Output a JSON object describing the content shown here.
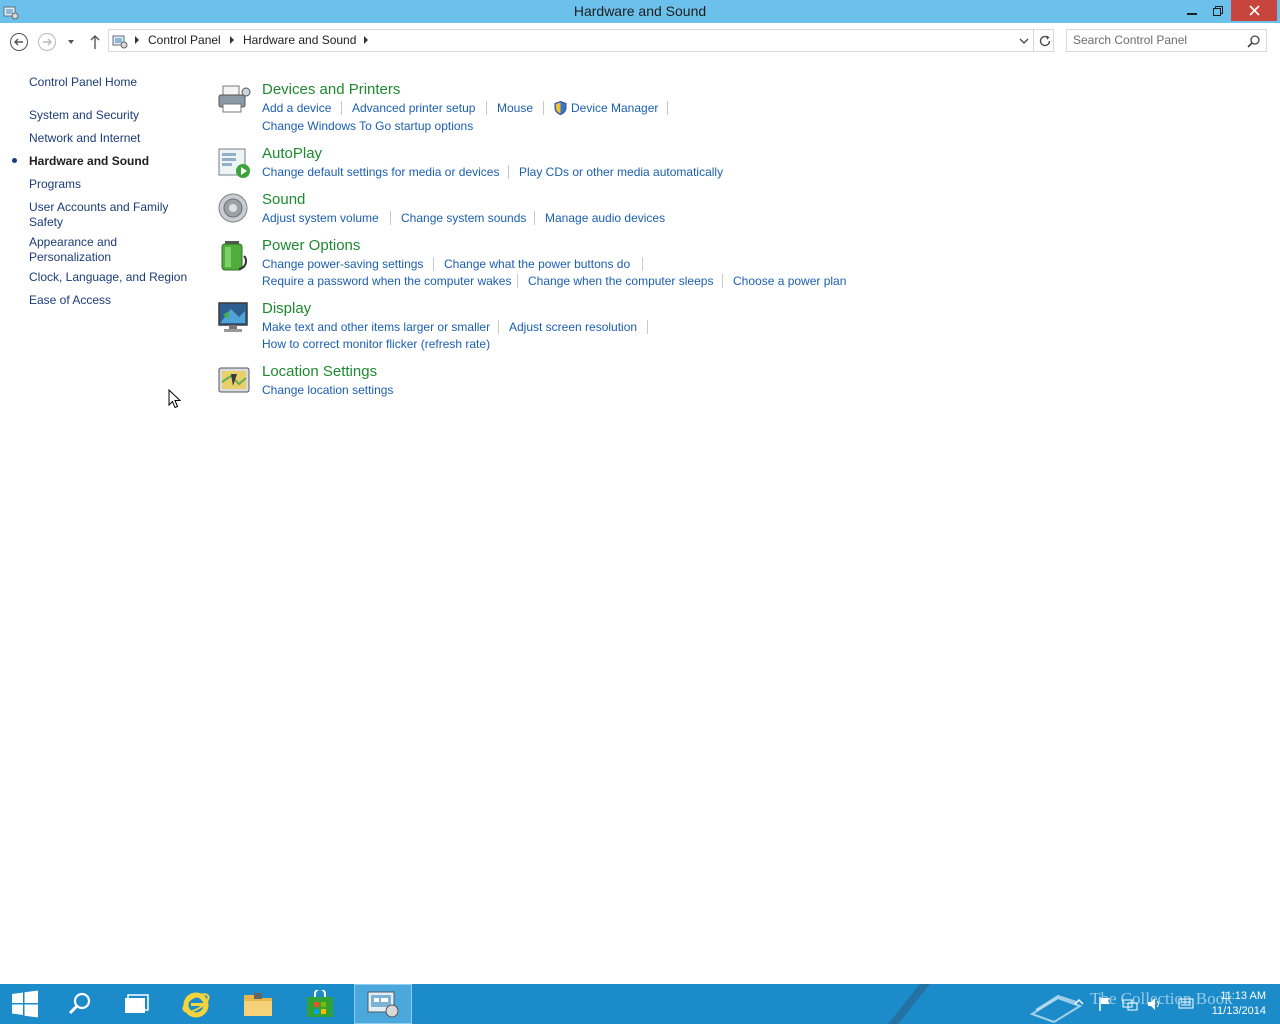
{
  "window": {
    "title": "Hardware and Sound"
  },
  "address": {
    "crumbs": [
      "Control Panel",
      "Hardware and Sound"
    ]
  },
  "search": {
    "placeholder": "Search Control Panel"
  },
  "left_pane": {
    "items": [
      {
        "label": "Control Panel Home"
      },
      {
        "label": "System and Security"
      },
      {
        "label": "Network and Internet"
      },
      {
        "label": "Hardware and Sound",
        "current": true
      },
      {
        "label": "Programs"
      },
      {
        "label": "User Accounts and Family Safety"
      },
      {
        "label": "Appearance and Personalization"
      },
      {
        "label": "Clock, Language, and Region"
      },
      {
        "label": "Ease of Access"
      }
    ]
  },
  "categories": [
    {
      "title": "Devices and Printers",
      "icon": "printer-icon",
      "links": [
        "Add a device",
        "Advanced printer setup",
        "Mouse",
        "Device Manager",
        "Change Windows To Go startup options"
      ]
    },
    {
      "title": "AutoPlay",
      "icon": "autoplay-icon",
      "links": [
        "Change default settings for media or devices",
        "Play CDs or other media automatically"
      ]
    },
    {
      "title": "Sound",
      "icon": "speaker-icon",
      "links": [
        "Adjust system volume",
        "Change system sounds",
        "Manage audio devices"
      ]
    },
    {
      "title": "Power Options",
      "icon": "battery-icon",
      "links": [
        "Change power-saving settings",
        "Change what the power buttons do",
        "Require a password when the computer wakes",
        "Change when the computer sleeps",
        "Choose a power plan"
      ]
    },
    {
      "title": "Display",
      "icon": "monitor-icon",
      "links": [
        "Make text and other items larger or smaller",
        "Adjust screen resolution",
        "How to correct monitor flicker (refresh rate)"
      ]
    },
    {
      "title": "Location Settings",
      "icon": "location-icon",
      "links": [
        "Change location settings"
      ]
    }
  ],
  "taskbar": {
    "watermark": "The Collection Book",
    "time": "11:13 AM",
    "date": "11/13/2014"
  },
  "colors": {
    "titlebar": "#6cc1ec",
    "taskbar": "#1b8bc9",
    "category_title": "#1e8a30",
    "link": "#1b5fb1",
    "close_button": "#c7453d"
  }
}
